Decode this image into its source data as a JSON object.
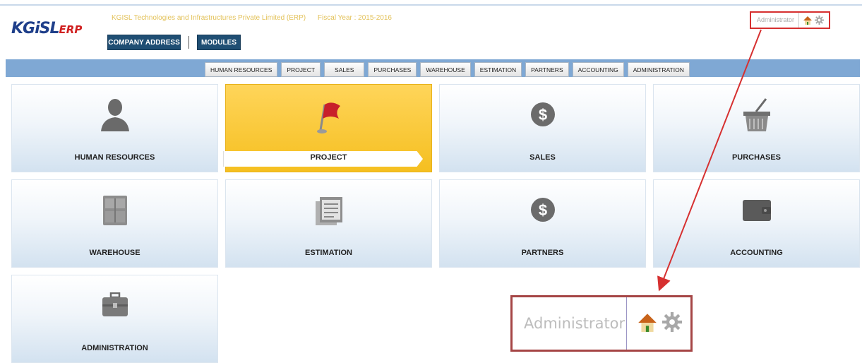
{
  "header": {
    "logo_main": "KGiSL",
    "logo_suffix": "ERP",
    "company_name": "KGISL Technologies and Infrastructures Private Limited (ERP)",
    "fiscal_year": "Fiscal Year : 2015-2016",
    "company_address_button": "COMPANY ADDRESS",
    "modules_button": "MODULES",
    "user_name": "Administrator"
  },
  "nav": {
    "tabs": [
      "HUMAN RESOURCES",
      "PROJECT",
      "SALES",
      "PURCHASES",
      "WAREHOUSE",
      "ESTIMATION",
      "PARTNERS",
      "ACCOUNTING",
      "ADMINISTRATION"
    ]
  },
  "tiles": [
    {
      "label": "HUMAN RESOURCES",
      "icon": "person-icon"
    },
    {
      "label": "PROJECT",
      "icon": "flag-icon",
      "active": true
    },
    {
      "label": "SALES",
      "icon": "dollar-icon"
    },
    {
      "label": "PURCHASES",
      "icon": "basket-icon"
    },
    {
      "label": "WAREHOUSE",
      "icon": "crate-icon"
    },
    {
      "label": "ESTIMATION",
      "icon": "document-icon"
    },
    {
      "label": "PARTNERS",
      "icon": "dollar-icon"
    },
    {
      "label": "ACCOUNTING",
      "icon": "wallet-icon"
    },
    {
      "label": "ADMINISTRATION",
      "icon": "briefcase-icon"
    }
  ],
  "zoom": {
    "user_name": "Administrator"
  },
  "colors": {
    "navbar": "#7fa8d4",
    "active_tile": "#f5bf20",
    "header_button": "#1f4e73",
    "highlight_red": "#d63030"
  }
}
